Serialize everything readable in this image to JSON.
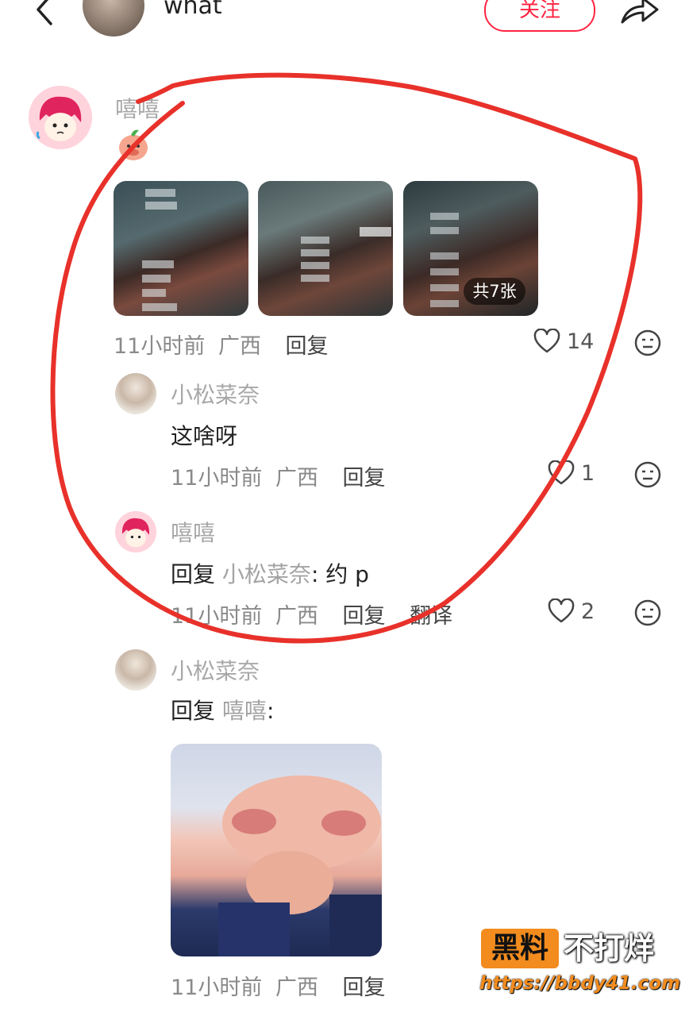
{
  "header": {
    "title": "what",
    "follow_label": "关注"
  },
  "comments": [
    {
      "author": "嘻嘻",
      "time": "11小时前",
      "region": "广西",
      "reply_label": "回复",
      "likes": "14",
      "images_badge": "共7张",
      "replies": [
        {
          "author": "小松菜奈",
          "text": "这啥呀",
          "time": "11小时前",
          "region": "广西",
          "reply_label": "回复",
          "likes": "1"
        },
        {
          "author": "嘻嘻",
          "prefix": "回复",
          "target": "小松菜奈",
          "text": ": 约 p",
          "time": "11小时前",
          "region": "广西",
          "reply_label": "回复",
          "translate_label": "翻译",
          "likes": "2"
        },
        {
          "author": "小松菜奈",
          "prefix": "回复",
          "target": "嘻嘻",
          "text": ":",
          "time": "11小时前",
          "region": "广西",
          "reply_label": "回复"
        }
      ]
    }
  ],
  "watermark": {
    "brand": "黑料",
    "slogan": "不打烊",
    "url": "https://bbdy41.com"
  },
  "colors": {
    "accent": "#ff2442",
    "annotation": "#e8312a",
    "watermark_orange": "#f28c1e"
  }
}
